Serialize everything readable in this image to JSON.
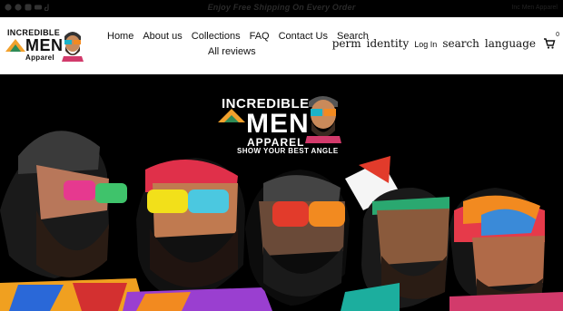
{
  "announcement": {
    "text": "Enjoy Free Shipping On Every Order"
  },
  "topbar": {
    "social_icons": [
      "facebook-icon",
      "pinterest-icon",
      "instagram-icon",
      "youtube-icon",
      "tiktok-icon"
    ],
    "right_text": "Inc Men Apparel"
  },
  "brand": {
    "line1": "INCREDIBLE",
    "line2": "MEN",
    "line3": "Apparel"
  },
  "nav": {
    "row1": [
      "Home",
      "About us",
      "Collections",
      "FAQ",
      "Contact Us",
      "Search"
    ],
    "row2": [
      "All reviews"
    ]
  },
  "header_right": {
    "perm": "perm",
    "identity": "identity",
    "login": "Log In",
    "search": "search",
    "language": "language",
    "cart_count": "0"
  },
  "hero": {
    "line1": "INCREDIBLE",
    "line2": "MEN",
    "line3": "APPAREL",
    "tagline": "SHOW YOUR BEST ANGLE"
  },
  "colors": {
    "header_bg": "#ffffff",
    "hero_bg": "#000000",
    "text": "#111111"
  }
}
